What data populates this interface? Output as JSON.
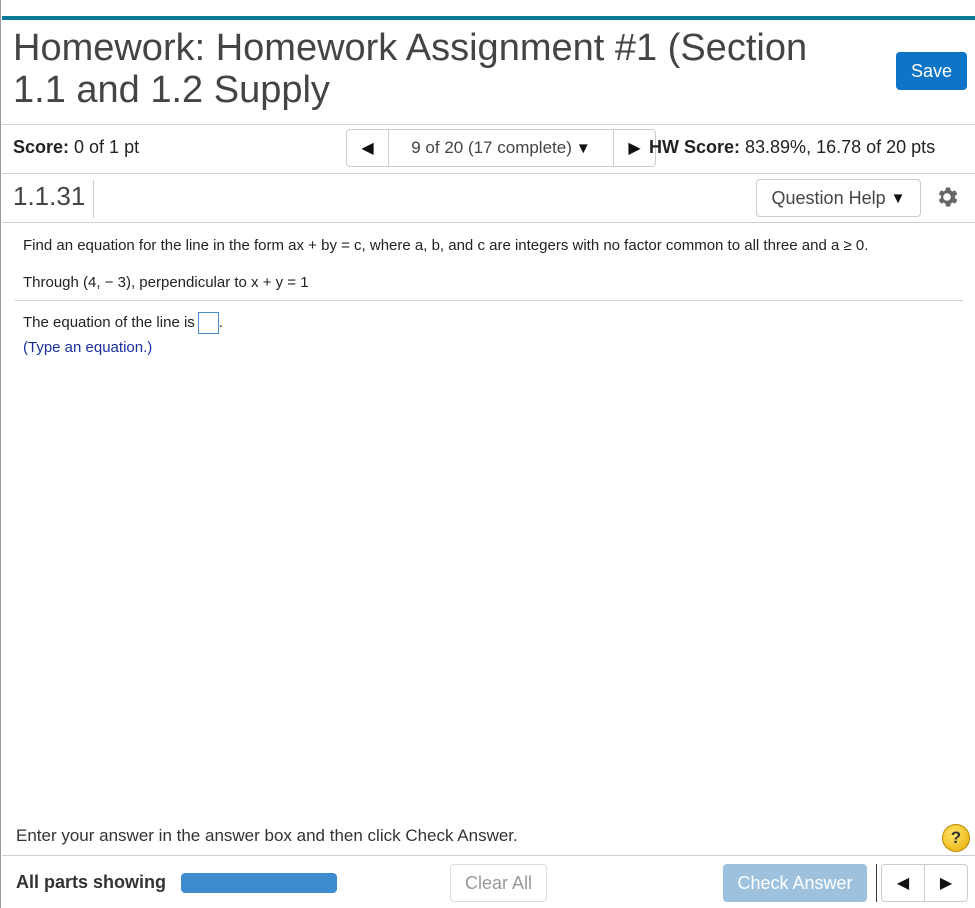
{
  "header": {
    "title": "Homework: Homework Assignment #1 (Section 1.1 and 1.2 Supply",
    "save_label": "Save"
  },
  "score_row": {
    "score_label": "Score:",
    "score_value": " 0 of 1 pt",
    "nav_position": "9 of 20 (17 complete)",
    "nav_caret": "▼",
    "nav_prev": "◀",
    "nav_next": "▶",
    "hw_score_label": "HW Score:",
    "hw_score_value": " 83.89%, 16.78 of 20 pts"
  },
  "question_bar": {
    "question_id": "1.1.31",
    "help_label": "Question Help",
    "help_caret": "▼"
  },
  "question": {
    "instruction": "Find an equation for the line in the form ax + by = c, where a, b, and c are integers with no factor common to all three and a ≥ 0.",
    "condition": "Through (4,  − 3), perpendicular to x + y = 1",
    "answer_prompt": "The equation of the line is",
    "answer_suffix": ".",
    "answer_value": "",
    "hint": "(Type an equation.)"
  },
  "footer": {
    "message": "Enter your answer in the answer box and then click Check Answer.",
    "help_icon": "?",
    "all_parts_label": "All parts showing",
    "progress_fraction": 1.0,
    "clear_all_label": "Clear All",
    "check_answer_label": "Check Answer",
    "prev": "◀",
    "next": "▶"
  }
}
